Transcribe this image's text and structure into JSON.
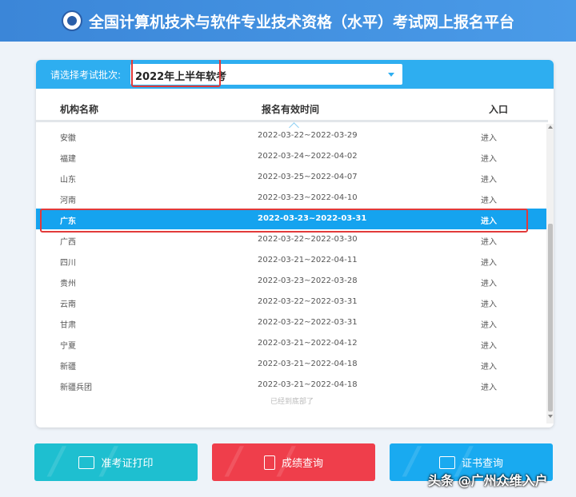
{
  "header": {
    "title": "全国计算机技术与软件专业技术资格（水平）考试网上报名平台"
  },
  "selector": {
    "label": "请选择考试批次:",
    "value": "2022年上半年软考"
  },
  "table": {
    "columns": [
      "机构名称",
      "报名有效时间",
      "入口"
    ],
    "rows": [
      {
        "name": "安徽",
        "period": "2022-03-22~2022-03-29",
        "entry": "进入"
      },
      {
        "name": "福建",
        "period": "2022-03-24~2022-04-02",
        "entry": "进入"
      },
      {
        "name": "山东",
        "period": "2022-03-25~2022-04-07",
        "entry": "进入"
      },
      {
        "name": "河南",
        "period": "2022-03-23~2022-04-10",
        "entry": "进入"
      },
      {
        "name": "广东",
        "period": "2022-03-23~2022-03-31",
        "entry": "进入",
        "active": true
      },
      {
        "name": "广西",
        "period": "2022-03-22~2022-03-30",
        "entry": "进入"
      },
      {
        "name": "四川",
        "period": "2022-03-21~2022-04-11",
        "entry": "进入"
      },
      {
        "name": "贵州",
        "period": "2022-03-23~2022-03-28",
        "entry": "进入"
      },
      {
        "name": "云南",
        "period": "2022-03-22~2022-03-31",
        "entry": "进入"
      },
      {
        "name": "甘肃",
        "period": "2022-03-22~2022-03-31",
        "entry": "进入"
      },
      {
        "name": "宁夏",
        "period": "2022-03-21~2022-04-12",
        "entry": "进入"
      },
      {
        "name": "新疆",
        "period": "2022-03-21~2022-04-18",
        "entry": "进入"
      },
      {
        "name": "新疆兵团",
        "period": "2022-03-21~2022-04-18",
        "entry": "进入"
      }
    ],
    "end_note": "已经到底部了"
  },
  "buttons": {
    "admit": "准考证打印",
    "score": "成绩查询",
    "cert": "证书查询"
  },
  "watermark": "头条 @广州众维入户",
  "colors": {
    "header": "#3b86d8",
    "accent": "#2eaef0",
    "active_row": "#15a3ef",
    "score_btn": "#ef3e4b",
    "admit_btn": "#1ebfd0",
    "highlight": "#e23a3a"
  }
}
